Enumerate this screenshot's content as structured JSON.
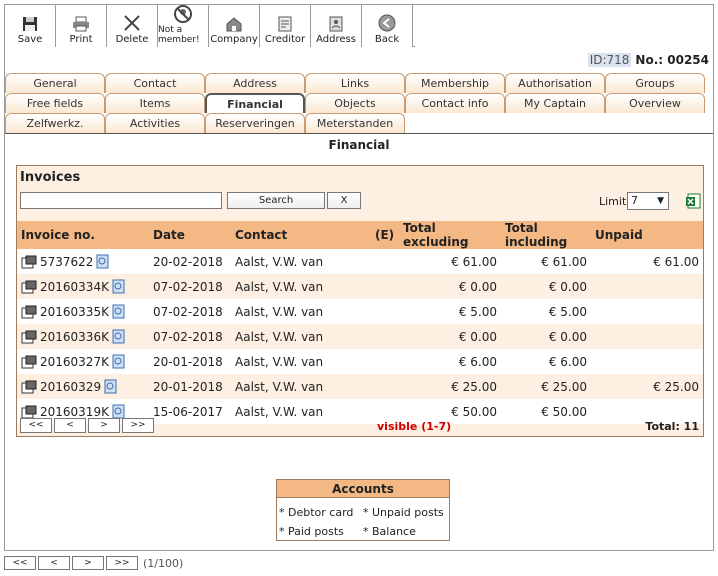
{
  "toolbar": {
    "save": "Save",
    "print": "Print",
    "delete": "Delete",
    "not_member": "Not a member!",
    "company": "Company",
    "creditor": "Creditor",
    "address": "Address",
    "back": "Back"
  },
  "record": {
    "id": "ID:718",
    "no": "No.: 00254"
  },
  "tabs": {
    "row1": [
      "General",
      "Contact",
      "Address",
      "Links",
      "Membership",
      "Authorisation",
      "Groups"
    ],
    "row2": [
      "Free fields",
      "Items",
      "Financial",
      "Objects",
      "Contact info",
      "My Captain",
      "Overview"
    ],
    "row3": [
      "Zelfwerkz.",
      "Activities",
      "Reserveringen",
      "Meterstanden"
    ],
    "active": "Financial"
  },
  "section_title": "Financial",
  "invoices": {
    "title": "Invoices",
    "search_value": "",
    "search_button": "Search",
    "clear_button": "X",
    "limit_label": "Limit",
    "limit_value": "7",
    "columns": [
      "Invoice no.",
      "Date",
      "Contact",
      "(E)",
      "Total excluding",
      "Total including",
      "Unpaid"
    ],
    "rows": [
      {
        "invoice": "5737622",
        "date": "20-02-2018",
        "contact": "Aalst, V.W. van",
        "e": "",
        "excl": "€ 61.00",
        "incl": "€ 61.00",
        "unpaid": "€ 61.00"
      },
      {
        "invoice": "20160334K",
        "date": "07-02-2018",
        "contact": "Aalst, V.W. van",
        "e": "",
        "excl": "€ 0.00",
        "incl": "€ 0.00",
        "unpaid": ""
      },
      {
        "invoice": "20160335K",
        "date": "07-02-2018",
        "contact": "Aalst, V.W. van",
        "e": "",
        "excl": "€ 5.00",
        "incl": "€ 5.00",
        "unpaid": ""
      },
      {
        "invoice": "20160336K",
        "date": "07-02-2018",
        "contact": "Aalst, V.W. van",
        "e": "",
        "excl": "€ 0.00",
        "incl": "€ 0.00",
        "unpaid": ""
      },
      {
        "invoice": "20160327K",
        "date": "20-01-2018",
        "contact": "Aalst, V.W. van",
        "e": "",
        "excl": "€ 6.00",
        "incl": "€ 6.00",
        "unpaid": ""
      },
      {
        "invoice": "20160329",
        "date": "20-01-2018",
        "contact": "Aalst, V.W. van",
        "e": "",
        "excl": "€ 25.00",
        "incl": "€ 25.00",
        "unpaid": "€ 25.00"
      },
      {
        "invoice": "20160319K",
        "date": "15-06-2017",
        "contact": "Aalst, V.W. van",
        "e": "",
        "excl": "€ 50.00",
        "incl": "€ 50.00",
        "unpaid": ""
      }
    ],
    "pager": [
      "<<",
      "<",
      ">",
      ">>"
    ],
    "visible": "visible (1-7)",
    "total": "Total: 11"
  },
  "accounts": {
    "title": "Accounts",
    "debtor_card": "* Debtor card",
    "unpaid_posts": "* Unpaid posts",
    "paid_posts": "* Paid posts",
    "balance": "* Balance"
  },
  "bottom_pager": {
    "buttons": [
      "<<",
      "<",
      ">",
      ">>"
    ],
    "page": "(1/100)"
  },
  "colors": {
    "header_orange": "#f4b885",
    "panel_bg": "#fdf0e2",
    "visible_red": "#cc0000"
  }
}
